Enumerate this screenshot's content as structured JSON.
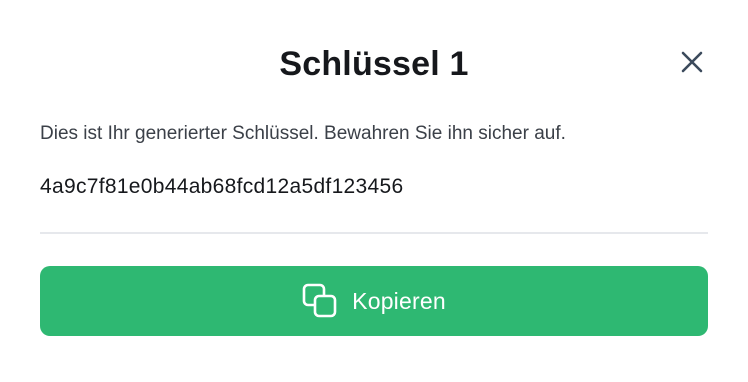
{
  "dialog": {
    "title": "Schlüssel 1",
    "description": "Dies ist Ihr generierter Schlüssel. Bewahren Sie ihn sicher auf.",
    "key_value": "4a9c7f81e0b44ab68fcd12a5df123456",
    "copy_label": "Kopieren",
    "close_icon": "close-icon",
    "copy_icon": "copy-icon"
  },
  "colors": {
    "accent": "#2eb872",
    "text": "#16181c",
    "muted_text": "#3b4048",
    "divider": "#e6e8ec"
  }
}
